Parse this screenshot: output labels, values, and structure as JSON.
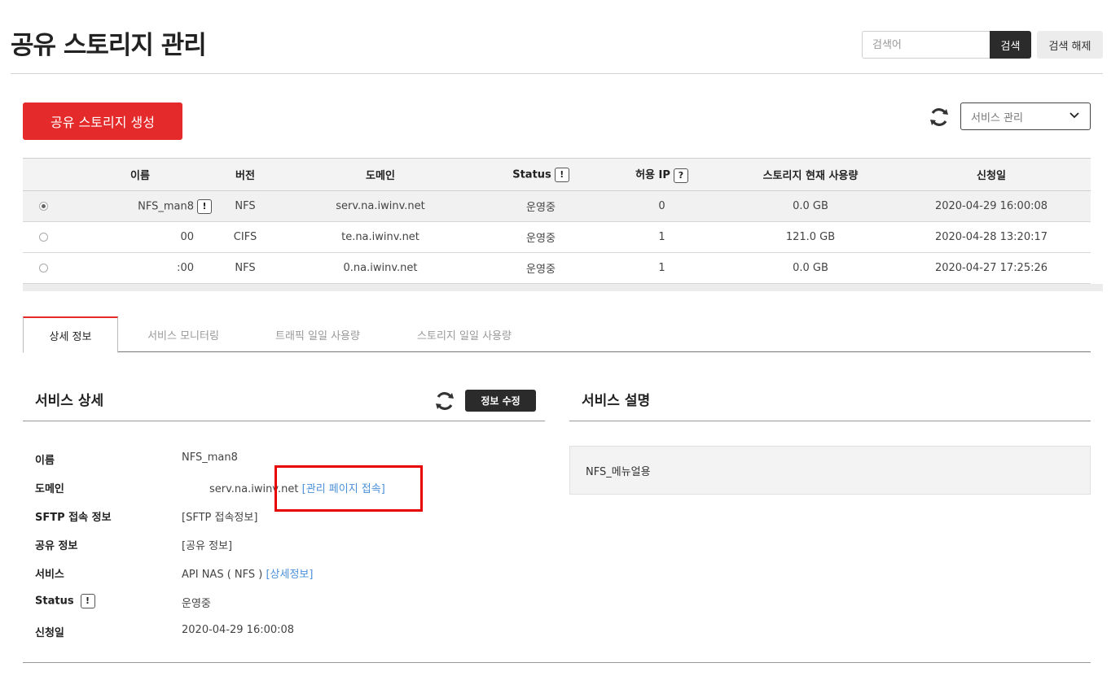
{
  "page": {
    "title": "공유 스토리지 관리"
  },
  "search": {
    "placeholder": "검색어",
    "value": "",
    "search_label": "검색",
    "clear_label": "검색 해제"
  },
  "toolbar": {
    "create_label": "공유 스토리지 생성",
    "service_select": "서비스 관리"
  },
  "table": {
    "headers": {
      "name": "이름",
      "version": "버전",
      "domain": "도메인",
      "status": "Status",
      "status_badge": "!",
      "allowed_ip": "허용 IP",
      "allowed_ip_badge": "?",
      "usage": "스토리지 현재 사용량",
      "date": "신청일"
    },
    "rows": [
      {
        "selected": true,
        "name": "NFS_man8",
        "name_badge": "!",
        "version": "NFS",
        "domain": "serv.na.iwinv.net",
        "status": "운영중",
        "ip": "0",
        "usage": "0.0 GB",
        "date": "2020-04-29 16:00:08"
      },
      {
        "selected": false,
        "name": "00",
        "name_badge": "",
        "version": "CIFS",
        "domain": "te.na.iwinv.net",
        "status": "운영중",
        "ip": "1",
        "usage": "121.0 GB",
        "date": "2020-04-28 13:20:17"
      },
      {
        "selected": false,
        "name": ":00",
        "name_badge": "",
        "version": "NFS",
        "domain": "0.na.iwinv.net",
        "status": "운영중",
        "ip": "1",
        "usage": "0.0 GB",
        "date": "2020-04-27 17:25:26"
      }
    ]
  },
  "tabs": [
    {
      "label": "상세 정보",
      "active": true
    },
    {
      "label": "서비스 모니터링",
      "active": false
    },
    {
      "label": "트래픽 일일 사용량",
      "active": false
    },
    {
      "label": "스토리지 일일 사용량",
      "active": false
    }
  ],
  "detail": {
    "title": "서비스 상세",
    "edit_label": "정보 수정",
    "name_label": "이름",
    "name_value": "NFS_man8",
    "domain_label": "도메인",
    "domain_value": "serv.na.iwinv.net",
    "domain_link": "[관리 페이지 접속]",
    "sftp_label": "SFTP 접속 정보",
    "sftp_link": "[SFTP 접속정보]",
    "share_label": "공유 정보",
    "share_link": "[공유 정보]",
    "service_label": "서비스",
    "service_value": "API NAS ( NFS )",
    "service_link": "[상세정보]",
    "status_label": "Status",
    "status_badge": "!",
    "status_value": "운영중",
    "date_label": "신청일",
    "date_value": "2020-04-29 16:00:08"
  },
  "description": {
    "title": "서비스 설명",
    "text": "NFS_메뉴얼용"
  },
  "colors": {
    "accent": "#e42a2a",
    "dark_button": "#2b2b2b",
    "link": "#4a90d9",
    "highlight": "#e60000"
  }
}
